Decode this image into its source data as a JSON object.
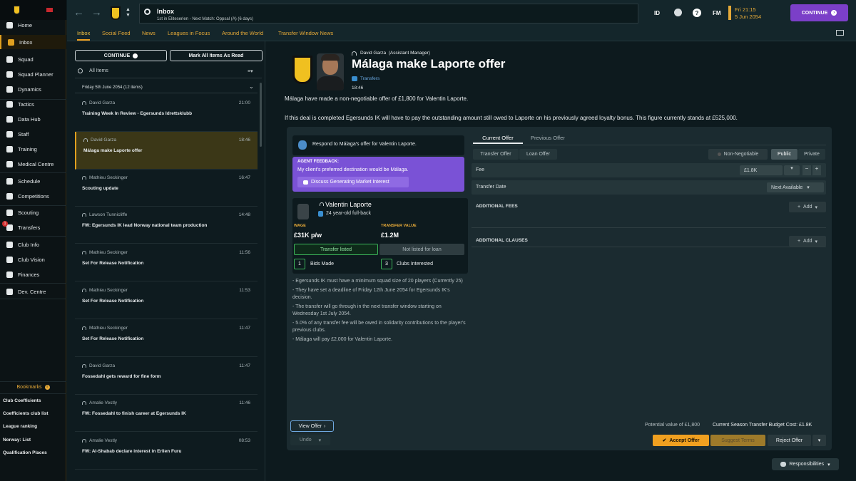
{
  "sidebar": {
    "items": [
      {
        "label": "Home",
        "icon": "home-icon"
      },
      {
        "label": "Inbox",
        "icon": "inbox-icon"
      },
      {
        "label": "Squad",
        "icon": "squad-icon"
      },
      {
        "label": "Squad Planner",
        "icon": "planner-icon"
      },
      {
        "label": "Dynamics",
        "icon": "dynamics-icon"
      },
      {
        "label": "Tactics",
        "icon": "tactics-icon"
      },
      {
        "label": "Data Hub",
        "icon": "data-hub-icon"
      },
      {
        "label": "Staff",
        "icon": "staff-icon"
      },
      {
        "label": "Training",
        "icon": "training-icon"
      },
      {
        "label": "Medical Centre",
        "icon": "medical-icon"
      },
      {
        "label": "Schedule",
        "icon": "schedule-icon"
      },
      {
        "label": "Competitions",
        "icon": "trophy-icon"
      },
      {
        "label": "Scouting",
        "icon": "scouting-icon"
      },
      {
        "label": "Transfers",
        "icon": "transfers-icon",
        "badge": "1"
      },
      {
        "label": "Club Info",
        "icon": "info-icon"
      },
      {
        "label": "Club Vision",
        "icon": "vision-icon"
      },
      {
        "label": "Finances",
        "icon": "finances-icon"
      },
      {
        "label": "Dev. Centre",
        "icon": "dev-centre-icon"
      }
    ],
    "bookmarks_title": "Bookmarks",
    "bookmarks": [
      "Club Coefficients",
      "Coefficients club list",
      "League ranking",
      "Norway: List",
      "Qualification Places"
    ]
  },
  "header": {
    "title": "Inbox",
    "subtitle": "1st in Eliteserien - Next Match: Oppsal (A) (6 days)",
    "id_label": "ID",
    "fm_label": "FM",
    "date_line1": "Fri 21:15",
    "date_line2": "5 Jun 2054",
    "continue_label": "CONTINUE"
  },
  "tabs": [
    "Inbox",
    "Social Feed",
    "News",
    "Leagues in Focus",
    "Around the World",
    "Transfer Window News"
  ],
  "left": {
    "continue_label": "CONTINUE",
    "mark_all_label": "Mark All Items As Read",
    "filter_label": "All Items",
    "group_header": "Friday 5th June 2054 (12 items)",
    "messages": [
      {
        "from": "David Garza",
        "time": "21:00",
        "subject": "Training Week In Review - Egersunds Idrettsklubb"
      },
      {
        "from": "David Garza",
        "time": "18:46",
        "subject": "Málaga make Laporte offer"
      },
      {
        "from": "Mathieu Seckinger",
        "time": "16:47",
        "subject": "Scouting update"
      },
      {
        "from": "Lawson Tunnicliffe",
        "time": "14:48",
        "subject": "FW: Egersunds IK lead Norway national team production"
      },
      {
        "from": "Mathieu Seckinger",
        "time": "11:56",
        "subject": "Set For Release Notification"
      },
      {
        "from": "Mathieu Seckinger",
        "time": "11:53",
        "subject": "Set For Release Notification"
      },
      {
        "from": "Mathieu Seckinger",
        "time": "11:47",
        "subject": "Set For Release Notification"
      },
      {
        "from": "David Garza",
        "time": "11:47",
        "subject": "Fossedahl gets reward for fine form"
      },
      {
        "from": "Amalie Vestly",
        "time": "11:46",
        "subject": "FW: Fossedahl to finish career at Egersunds IK"
      },
      {
        "from": "Amalie Vestly",
        "time": "08:53",
        "subject": "FW: Al-Shabab declare interest in Erlien Furu"
      }
    ]
  },
  "message": {
    "sender": "David Garza",
    "sender_role": "(Assistant Manager)",
    "title": "Málaga make Laporte offer",
    "category": "Transfers",
    "time": "18:46",
    "body1": "Málaga have made a non-negotiable offer of £1,800 for Valentin Laporte.",
    "body2": "If this deal is completed Egersunds IK will have to pay the outstanding amount still owed to Laporte on his previously agreed loyalty bonus. This figure currently stands at £525,000."
  },
  "offer": {
    "respond_text": "Respond to Málaga's offer for Valentin Laporte.",
    "agent_title": "AGENT FEEDBACK:",
    "agent_text": "My client's preferred destination would be Málaga.",
    "discuss_label": "Discuss Generating Market Interest",
    "player_name": "Valentin Laporte",
    "player_desc": "24 year-old full-back",
    "wage_label": "WAGE",
    "wage_value": "£31K p/w",
    "tv_label": "TRANSFER VALUE",
    "tv_value": "£1.2M",
    "listed_label": "Transfer listed",
    "loan_label": "Not listed for loan",
    "bids_count": "1",
    "bids_label": "Bids Made",
    "clubs_count": "3",
    "clubs_label": "Clubs Interested",
    "clauses": [
      "- Egersunds IK must have a minimum squad size of 20 players (Currently 25)",
      "- They have set a deadline of Friday 12th June 2054 for Egersunds IK's decision.",
      "- The transfer will go through in the next transfer window starting on Wednesday 1st July 2054.",
      "- 5.0% of any transfer fee will be owed in solidarity contributions to the player's previous clubs.",
      "- Málaga will pay £2,000 for Valentin Laporte."
    ],
    "current_tab": "Current Offer",
    "previous_tab": "Previous Offer",
    "transfer_offer": "Transfer Offer",
    "loan_offer": "Loan Offer",
    "non_negotiable": "Non-Negotiable",
    "public": "Public",
    "private": "Private",
    "fee_label": "Fee",
    "fee_value": "£1.8K",
    "date_label": "Transfer Date",
    "date_value": "Next Available",
    "add_fees": "ADDITIONAL FEES",
    "add_clauses": "ADDITIONAL CLAUSES",
    "add_label": "Add",
    "potential": "Potential value of £1,800",
    "budget": "Current Season Transfer Budget Cost: £1.8K",
    "view_offer": "View Offer",
    "undo": "Undo",
    "accept": "Accept Offer",
    "suggest": "Suggest Terms",
    "reject": "Reject Offer"
  },
  "footer": {
    "responsibilities": "Responsibilities"
  },
  "colors": {
    "accent": "#f0a020",
    "continue_btn": "#7b3fc8",
    "agent_box": "#7a52d6"
  }
}
